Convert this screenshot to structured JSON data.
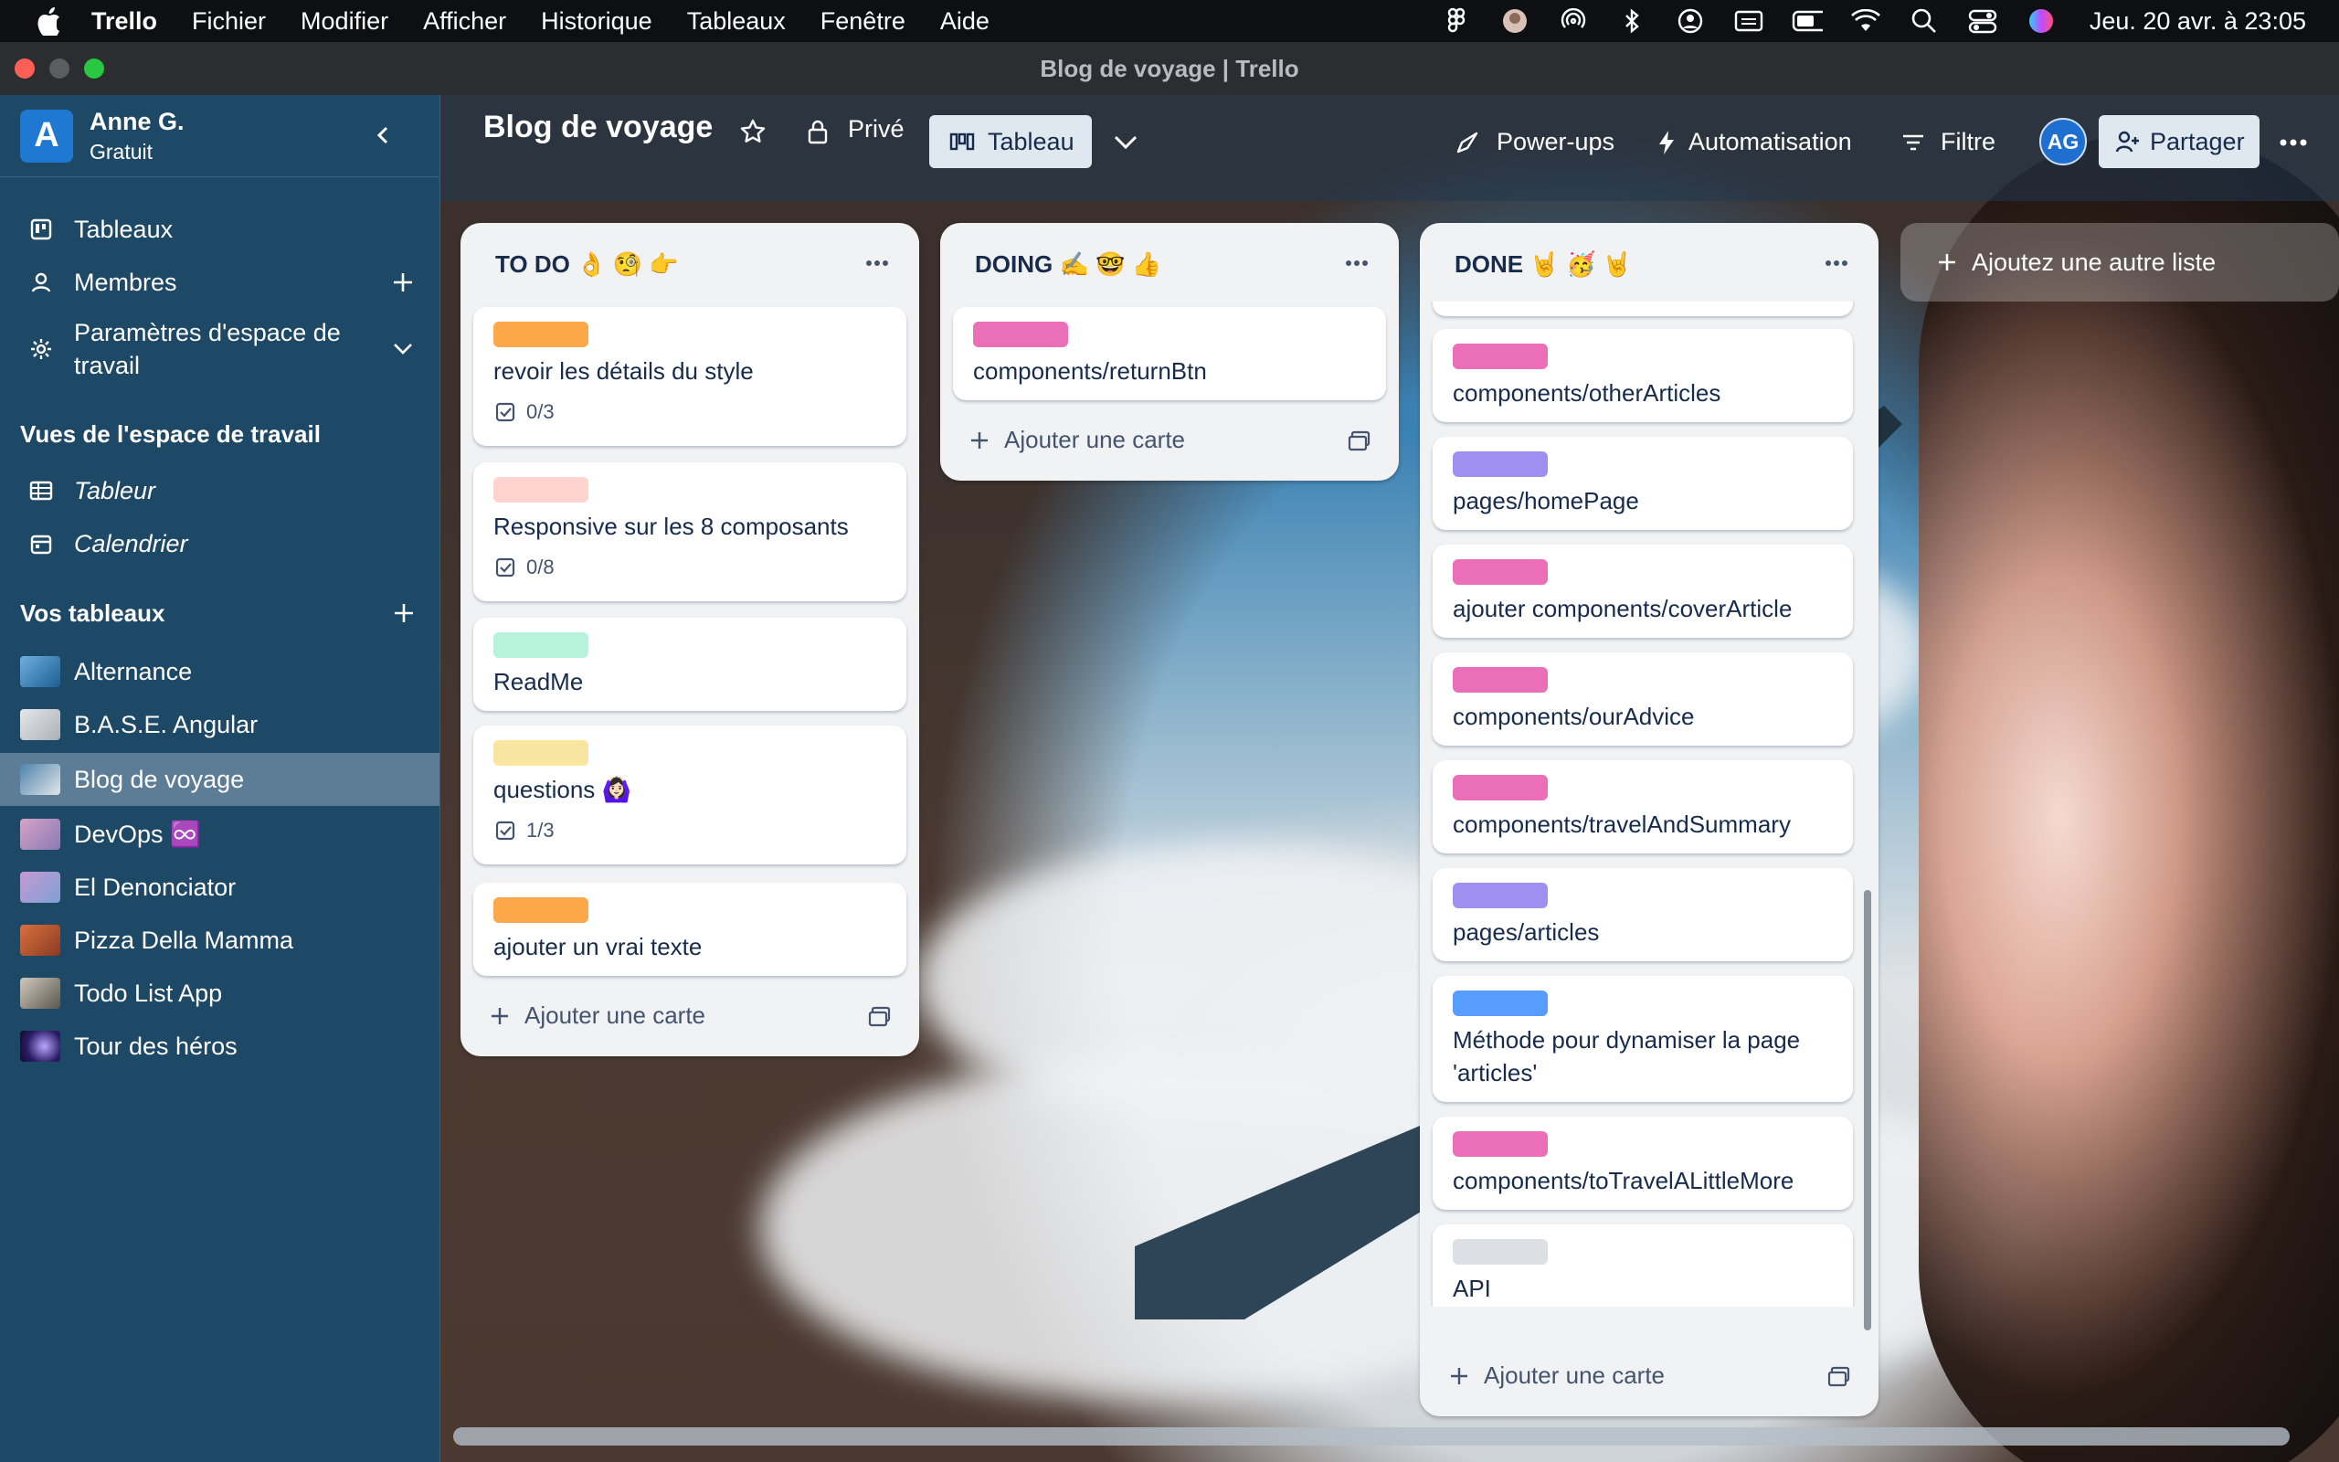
{
  "menubar": {
    "app": "Trello",
    "items": [
      "Fichier",
      "Modifier",
      "Afficher",
      "Historique",
      "Tableaux",
      "Fenêtre",
      "Aide"
    ],
    "clock": "Jeu. 20 avr. à  23:05"
  },
  "window": {
    "title": "Blog de voyage | Trello"
  },
  "workspace": {
    "initial": "A",
    "name": "Anne G.",
    "plan": "Gratuit"
  },
  "sidebar": {
    "nav": [
      {
        "label": "Tableaux",
        "icon": "trello-board-icon"
      },
      {
        "label": "Membres",
        "icon": "person-icon"
      },
      {
        "label": "Paramètres d'espace de travail",
        "icon": "gear-icon"
      }
    ],
    "views_heading": "Vues de l'espace de travail",
    "views": [
      {
        "label": "Tableur",
        "icon": "table-icon"
      },
      {
        "label": "Calendrier",
        "icon": "calendar-icon"
      }
    ],
    "boards_heading": "Vos tableaux",
    "boards": [
      {
        "label": "Alternance",
        "thumb": "#3b7fb8"
      },
      {
        "label": "B.A.S.E. Angular",
        "thumb": "#c9ced3"
      },
      {
        "label": "Blog de voyage",
        "thumb": "#7fa3bd"
      },
      {
        "label": "DevOps ♾️",
        "thumb": "#b89ab8"
      },
      {
        "label": "El Denonciator",
        "thumb": "#a9a5d4"
      },
      {
        "label": "Pizza Della Mamma",
        "thumb": "#b5583b"
      },
      {
        "label": "Todo List App",
        "thumb": "#9e9a90"
      },
      {
        "label": "Tour des héros",
        "thumb": "#3b2a78"
      }
    ]
  },
  "board": {
    "title": "Blog de voyage",
    "visibility": "Privé",
    "view": "Tableau",
    "powerups": "Power-ups",
    "automation": "Automatisation",
    "filter": "Filtre",
    "avatar": "AG",
    "share": "Partager",
    "add_list": "Ajoutez une autre liste"
  },
  "lists": [
    {
      "title": "TO DO 👌 🧐 👉",
      "add_card": "Ajouter une carte",
      "cards": [
        {
          "label_color": "#fca74a",
          "title": "revoir les détails du style",
          "checklist": "0/3"
        },
        {
          "label_color": "#ffd3cf",
          "title": "Responsive sur les 8 composants",
          "checklist": "0/8"
        },
        {
          "label_color": "#b9f2dc",
          "title": "ReadMe"
        },
        {
          "label_color": "#f8e6a0",
          "title": "questions 🙆🏻‍♀️",
          "checklist": "1/3"
        },
        {
          "label_color": "#fca74a",
          "title": "ajouter un vrai texte"
        }
      ]
    },
    {
      "title": "DOING ✍️ 🤓 👍",
      "add_card": "Ajouter une carte",
      "cards": [
        {
          "label_color": "#ea6fb8",
          "title": "components/returnBtn"
        }
      ]
    },
    {
      "title": "DONE 🤘 🥳 🤘",
      "add_card": "Ajouter une carte",
      "cards": [
        {
          "label_color": "#ea6fb8",
          "title": "components/otherArticles"
        },
        {
          "label_color": "#9f8fef",
          "title": "pages/homePage"
        },
        {
          "label_color": "#ea6fb8",
          "title": "ajouter components/coverArticle"
        },
        {
          "label_color": "#ea6fb8",
          "title": "components/ourAdvice"
        },
        {
          "label_color": "#ea6fb8",
          "title": "components/travelAndSummary"
        },
        {
          "label_color": "#9f8fef",
          "title": "pages/articles"
        },
        {
          "label_color": "#579dff",
          "title": "Méthode pour dynamiser la page 'articles'"
        },
        {
          "label_color": "#ea6fb8",
          "title": "components/toTravelALittleMore"
        },
        {
          "label_color": "#dcdfe4",
          "title": "API"
        }
      ]
    }
  ]
}
